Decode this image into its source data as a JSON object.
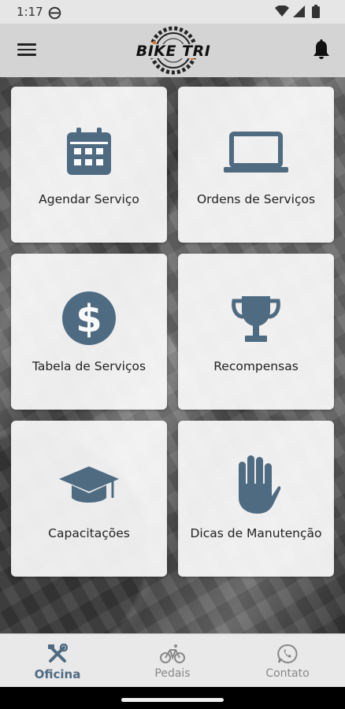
{
  "status_bar": {
    "time": "1:17"
  },
  "app_bar": {
    "menu_icon": "hamburger-menu-icon",
    "logo_text": "BIKE TRI",
    "notification_icon": "bell-icon"
  },
  "cards": [
    {
      "label": "Agendar Serviço",
      "icon": "calendar-icon"
    },
    {
      "label": "Ordens de Serviços",
      "icon": "laptop-icon"
    },
    {
      "label": "Tabela de Serviços",
      "icon": "dollar-icon"
    },
    {
      "label": "Recompensas",
      "icon": "trophy-icon"
    },
    {
      "label": "Capacitações",
      "icon": "graduation-cap-icon"
    },
    {
      "label": "Dicas de Manutenção",
      "icon": "hand-icon"
    }
  ],
  "bottom_nav": [
    {
      "label": "Oficina",
      "icon": "tools-icon",
      "active": true
    },
    {
      "label": "Pedais",
      "icon": "bicycle-icon",
      "active": false
    },
    {
      "label": "Contato",
      "icon": "whatsapp-icon",
      "active": false
    }
  ],
  "colors": {
    "accent": "#4f6b82",
    "card_bg": "#fafafa",
    "appbar_bg": "#d4d4d4",
    "inactive": "#888888"
  }
}
